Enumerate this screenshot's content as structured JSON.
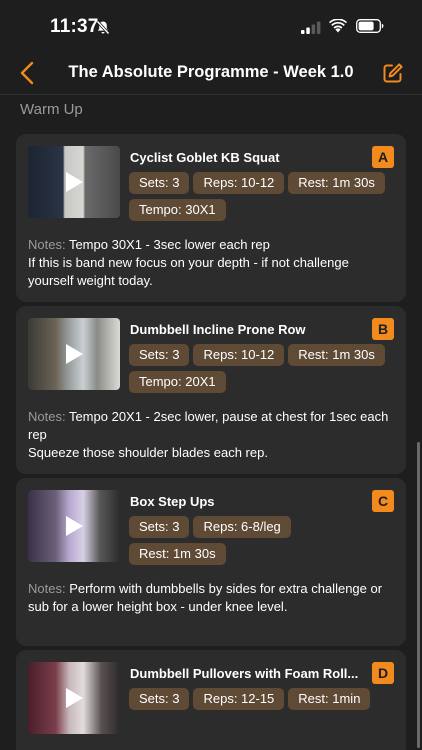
{
  "status": {
    "time": "11:37"
  },
  "nav": {
    "title": "The Absolute Programme - Week 1.0"
  },
  "section": {
    "title": "Warm Up"
  },
  "exercises": [
    {
      "letter": "A",
      "name": "Cyclist Goblet KB Squat",
      "sets": "Sets: 3",
      "reps": "Reps: 10-12",
      "rest": "Rest: 1m 30s",
      "tempo": "Tempo: 30X1",
      "notes_label": "Notes: ",
      "notes_line1": "Tempo 30X1 - 3sec lower each rep",
      "notes_line2": "If this is band new focus on your depth - if not challenge yourself weight today."
    },
    {
      "letter": "B",
      "name": "Dumbbell Incline Prone Row",
      "sets": "Sets: 3",
      "reps": "Reps: 10-12",
      "rest": "Rest: 1m 30s",
      "tempo": "Tempo: 20X1",
      "notes_label": "Notes: ",
      "notes_line1": "Tempo 20X1 - 2sec lower, pause at chest for 1sec each rep",
      "notes_line2": "Squeeze those shoulder blades each rep."
    },
    {
      "letter": "C",
      "name": "Box Step Ups",
      "sets": "Sets: 3",
      "reps": "Reps: 6-8/leg",
      "rest": "Rest: 1m 30s",
      "notes_label": "Notes: ",
      "notes_line1": "Perform with dumbbells by sides for extra challenge or sub for a lower height box - under knee level."
    },
    {
      "letter": "D",
      "name": "Dumbbell Pullovers with Foam Roll...",
      "sets": "Sets: 3",
      "reps": "Reps: 12-15",
      "rest": "Rest: 1min"
    }
  ],
  "colors": {
    "accent": "#f28a1e",
    "tag_bg": "#5f4a36",
    "card_bg": "#2c2c2c",
    "bg": "#1e1e1e"
  },
  "icons": {
    "back": "chevron-left-icon",
    "edit": "edit-icon",
    "play": "play-icon"
  }
}
